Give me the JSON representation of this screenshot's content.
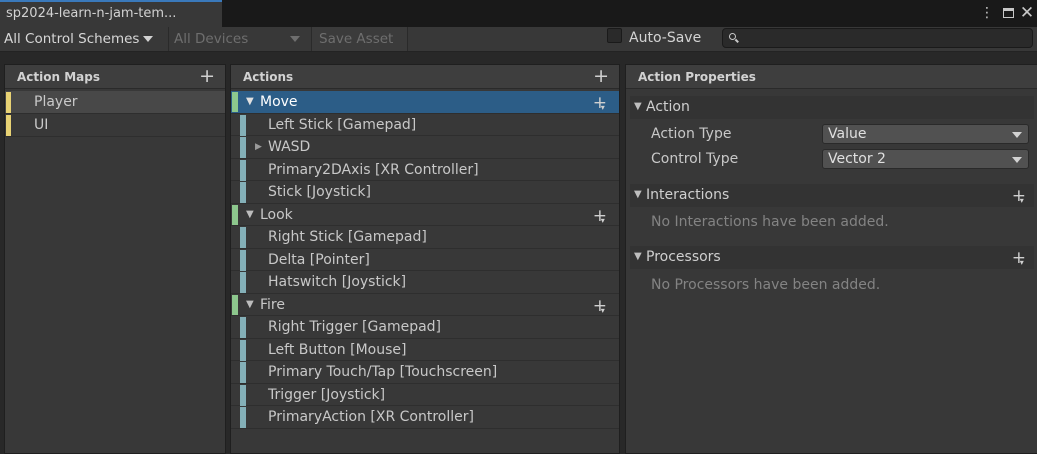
{
  "window": {
    "tab_title": "sp2024-learn-n-jam-tem...",
    "kebab_icon": "vertical-ellipsis",
    "maximize_icon": "maximize-window",
    "close_icon": "x"
  },
  "toolbar": {
    "control_schemes": "All Control Schemes",
    "devices": "All Devices",
    "save_asset": "Save Asset",
    "auto_save_label": "Auto-Save",
    "auto_save_checked": false,
    "search_value": "",
    "search_placeholder": ""
  },
  "action_maps": {
    "title": "Action Maps",
    "items": [
      {
        "label": "Player",
        "selected": true
      },
      {
        "label": "UI",
        "selected": false
      }
    ]
  },
  "actions": {
    "title": "Actions",
    "tree": [
      {
        "label": "Move",
        "bindings": [
          "Left Stick [Gamepad]",
          "WASD",
          "Primary2DAxis [XR Controller]",
          "Stick [Joystick]"
        ]
      },
      {
        "label": "Look",
        "bindings": [
          "Right Stick [Gamepad]",
          "Delta [Pointer]",
          "Hatswitch [Joystick]"
        ]
      },
      {
        "label": "Fire",
        "bindings": [
          "Right Trigger [Gamepad]",
          "Left Button [Mouse]",
          "Primary Touch/Tap [Touchscreen]",
          "Trigger [Joystick]",
          "PrimaryAction [XR Controller]"
        ]
      }
    ]
  },
  "properties": {
    "title": "Action Properties",
    "action_section": "Action",
    "action_type_label": "Action Type",
    "action_type_value": "Value",
    "control_type_label": "Control Type",
    "control_type_value": "Vector 2",
    "interactions_section": "Interactions",
    "interactions_empty": "No Interactions have been added.",
    "processors_section": "Processors",
    "processors_empty": "No Processors have been added."
  },
  "colors": {
    "accent_tab": "#3a79bb",
    "selected_row": "#2c5d87",
    "map_stripe": "#e8d274",
    "action_stripe": "#8dc78d",
    "binding_stripe": "#84b0b8"
  }
}
